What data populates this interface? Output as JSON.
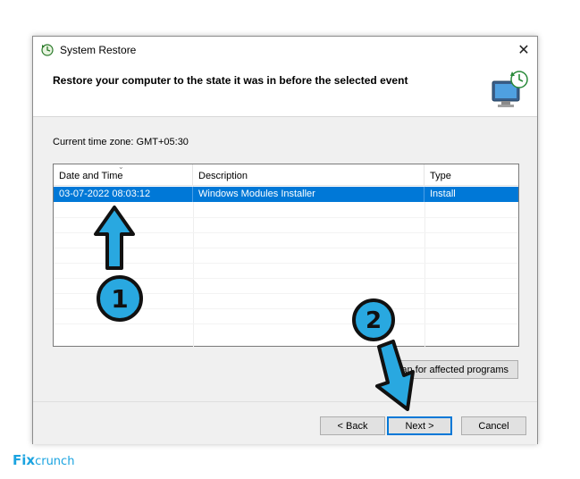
{
  "window": {
    "title": "System Restore",
    "close_glyph": "✕",
    "header_text": "Restore your computer to the state it was in before the selected event"
  },
  "timezone": {
    "label": "Current time zone: GMT+05:30"
  },
  "table": {
    "columns": [
      "Date and Time",
      "Description",
      "Type"
    ],
    "sort_glyph": "⌄",
    "rows": [
      {
        "date": "03-07-2022 08:03:12",
        "description": "Windows Modules Installer",
        "type": "Install",
        "selected": true
      }
    ]
  },
  "buttons": {
    "scan_label": "an for affected programs",
    "back_label": "< Back",
    "next_label": "Next >",
    "cancel_label": "Cancel"
  },
  "annotations": {
    "step1": "1",
    "step2": "2"
  },
  "logo": {
    "part1": "Fix",
    "part2": "crunch"
  },
  "colors": {
    "selection": "#0078d7",
    "annotation_fill": "#29a8e0",
    "annotation_stroke": "#111111"
  }
}
